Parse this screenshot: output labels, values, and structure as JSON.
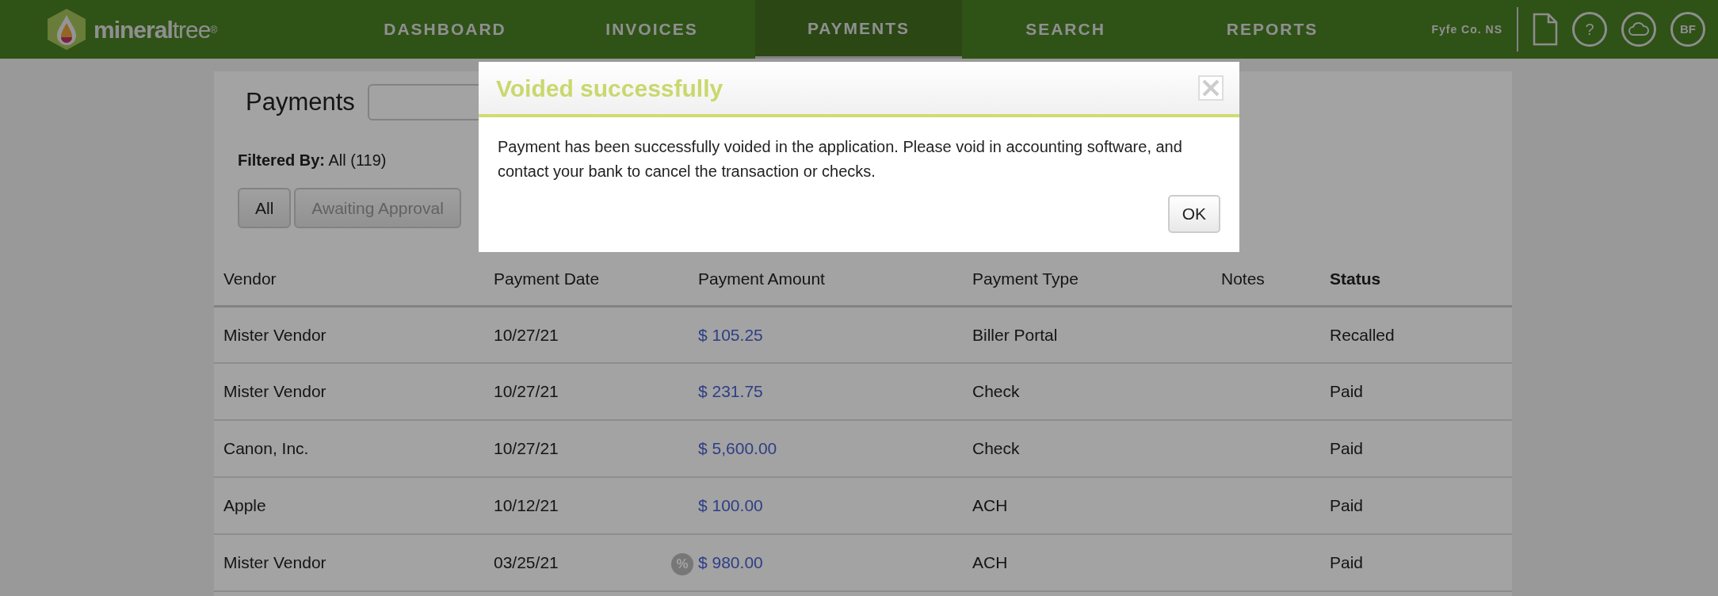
{
  "header": {
    "logo": "**mineral**tree$^{®}$",
    "nav": [
      {
        "label": "DASHBOARD",
        "selected": false
      },
      {
        "label": "INVOICES",
        "selected": false
      },
      {
        "label": "PAYMENTS",
        "selected": true
      },
      {
        "label": "SEARCH",
        "selected": false
      },
      {
        "label": "REPORTS",
        "selected": false
      }
    ],
    "company": "Fyfe Co. NS",
    "help": "?",
    "avatar": "BF"
  },
  "page": {
    "title": "Payments",
    "filter_text": "**Filtered By:** All (119)",
    "filters": [
      {
        "label": "All",
        "selected": true
      },
      {
        "label": "Awaiting Approval",
        "selected": false
      }
    ]
  },
  "table": {
    "columns": [
      {
        "label": "Vendor",
        "sorted": false
      },
      {
        "label": "Payment Date",
        "sorted": false
      },
      {
        "label": "Payment Amount",
        "sorted": false
      },
      {
        "label": "Payment Type",
        "sorted": false
      },
      {
        "label": "Notes",
        "sorted": false
      },
      {
        "label": "Status",
        "sorted": true
      }
    ],
    "rows": [
      {
        "vendor": "Mister Vendor",
        "date": "10/27/21",
        "amount": "$ 105.25",
        "type": "Biller Portal",
        "status": "Recalled"
      },
      {
        "vendor": "Mister Vendor",
        "date": "10/27/21",
        "amount": "$ 231.75",
        "type": "Check",
        "status": "Paid"
      },
      {
        "vendor": "Canon, Inc.",
        "date": "10/27/21",
        "amount": "$ 5,600.00",
        "type": "Check",
        "status": "Paid"
      },
      {
        "vendor": "Apple",
        "date": "10/12/21",
        "amount": "$ 100.00",
        "type": "ACH",
        "status": "Paid"
      },
      {
        "vendor": "Mister Vendor",
        "date": "03/25/21",
        "badge": "%",
        "amount": "$ 980.00",
        "type": "ACH",
        "status": "Paid"
      }
    ]
  },
  "modal": {
    "title": "Voided successfully",
    "message": "Payment has been successfully voided in the application. Please void in accounting software, and contact your bank to cancel the transaction or checks.",
    "button": "OK"
  }
}
